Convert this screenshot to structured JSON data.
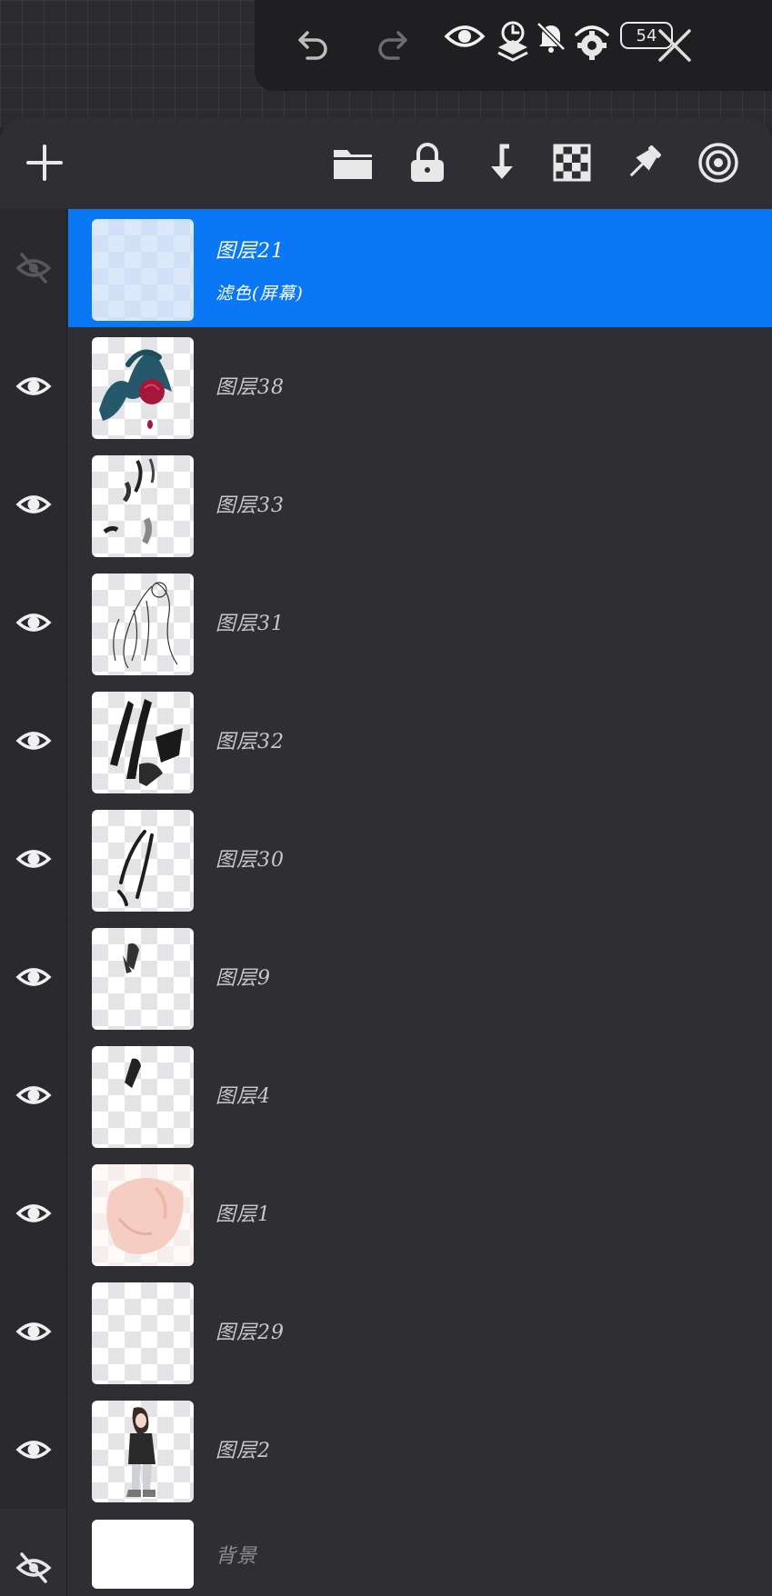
{
  "topbar": {
    "badge": "54",
    "icons": [
      "undo-icon",
      "redo-icon",
      "eye-icon",
      "layers-icon",
      "alarm-icon",
      "mute-bell-icon",
      "settings-icon",
      "close-icon"
    ]
  },
  "panel_toolbar": {
    "icons": [
      "add-icon",
      "folder-icon",
      "lock-icon",
      "merge-down-icon",
      "checkerboard-icon",
      "pin-icon",
      "target-icon"
    ]
  },
  "layers": [
    {
      "name": "图层21",
      "blend_mode": "滤色(屏幕)",
      "selected": true,
      "visible": false,
      "thumb": "blank"
    },
    {
      "name": "图层38",
      "selected": false,
      "visible": true,
      "thumb": "rose"
    },
    {
      "name": "图层33",
      "selected": false,
      "visible": true,
      "thumb": "strokes"
    },
    {
      "name": "图层31",
      "selected": false,
      "visible": true,
      "thumb": "lineart"
    },
    {
      "name": "图层32",
      "selected": false,
      "visible": true,
      "thumb": "hair"
    },
    {
      "name": "图层30",
      "selected": false,
      "visible": true,
      "thumb": "strands"
    },
    {
      "name": "图层9",
      "selected": false,
      "visible": true,
      "thumb": "small"
    },
    {
      "name": "图层4",
      "selected": false,
      "visible": true,
      "thumb": "tiny"
    },
    {
      "name": "图层1",
      "selected": false,
      "visible": true,
      "thumb": "skin"
    },
    {
      "name": "图层29",
      "selected": false,
      "visible": true,
      "thumb": "blank"
    },
    {
      "name": "图层2",
      "selected": false,
      "visible": true,
      "thumb": "figure"
    }
  ],
  "background_layer": {
    "name": "背景",
    "visible": false
  },
  "colors": {
    "accent": "#0a78f5",
    "panel": "#2f2e32",
    "topbar": "#1f1e21"
  }
}
